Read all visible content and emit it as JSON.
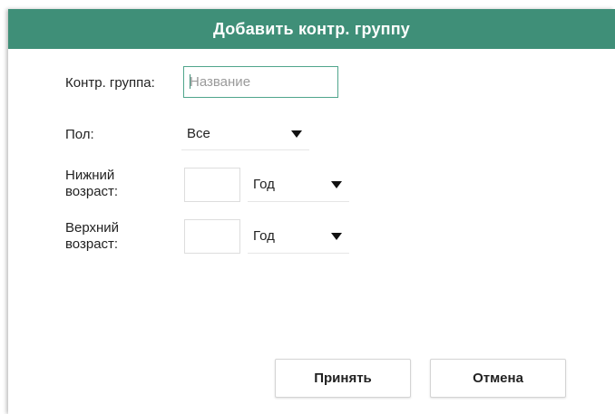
{
  "dialog": {
    "title": "Добавить контр. группу",
    "accent_color": "#3f8f78"
  },
  "form": {
    "group": {
      "label": "Контр. группа:",
      "placeholder": "Название",
      "value": ""
    },
    "sex": {
      "label": "Пол:",
      "selected": "Все"
    },
    "lower_age": {
      "label_line1": "Нижний",
      "label_line2": "возраст:",
      "value": "",
      "unit_selected": "Год"
    },
    "upper_age": {
      "label_line1": "Верхний",
      "label_line2": "возраст:",
      "value": "",
      "unit_selected": "Год"
    }
  },
  "buttons": {
    "accept_label": "Принять",
    "cancel_label": "Отмена"
  },
  "icons": {
    "dropdown": "triangle-down-icon"
  }
}
